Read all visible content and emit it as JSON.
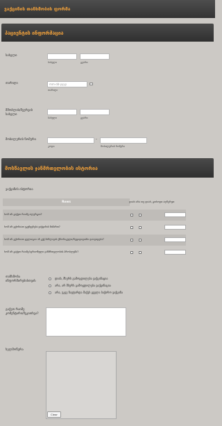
{
  "header": {
    "title": "ვაქცინის თანხმობის ფორმა"
  },
  "patient_section": {
    "title": "პაციენტის ინფორმაცია",
    "name_label": "სახელი",
    "first_name_sub": "სახელი",
    "last_name_sub": "გვარი",
    "dob_label": "თარიღი",
    "dob_placeholder": "mm-dd-yyyy",
    "dob_sub": "თარიღი",
    "guardian_label": "მშობლის/მეურვის სახელი",
    "guardian_first_sub": "სახელი",
    "guardian_last_sub": "გვარი",
    "phone_label": "მობილურის ნომერი",
    "phone_code_sub": "კოდი",
    "phone_number_sub": "მობილურის ნომერი"
  },
  "history_section": {
    "title": "მოსწავლის ჯანმრთელობის ისტორია",
    "table_label": "ვაქცინის ისტორია",
    "table_header": "Rows",
    "column_headers": "დიახ  არა  თუ დიახ, გთხოვთ აღწერეთ",
    "rows": [
      "ხომ არ გაქვთ რაიმე ალერგია?",
      "ხომ არ გქონიათ უკუჩვენება ვაქცინის მიმართ?",
      "ხომ არ გქონიათ ცელიაკია ან კუჭ-ნაწლავის ქრონიკული/რეციდივიანი დაავადება?",
      "ხომ არ გაქვთ რაიმე სერიოზული ჯანმრთელობის პრობლემა?"
    ],
    "consent_label": "თანხმობა ინფორმირებისთვის",
    "radio_options": [
      "დიახ, მსურს გამოცდილება ვაქცინაცია",
      "არა, არ მსურს გამოცდილება ვაქცინაცია",
      "არა, უკვე ჩაუტარდა მაქვს ყველა საჭირო ვაქცინა"
    ],
    "comments_label": "გაქვთ რაიმე კომენტარი/შეკითხვა?",
    "signature_label": "ხელმოწერა",
    "clear_button": "Clear"
  }
}
